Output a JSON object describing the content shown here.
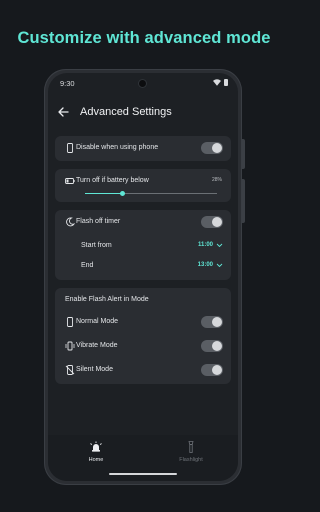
{
  "promo": {
    "title": "Customize with advanced mode"
  },
  "statusbar": {
    "time": "9:30"
  },
  "appbar": {
    "title": "Advanced Settings"
  },
  "settings": {
    "disable_when_using_phone": {
      "label": "Disable when using phone",
      "enabled": false
    },
    "battery": {
      "label": "Turn off if battery below",
      "value_text": "28%",
      "level": 0.28
    },
    "flash_off_timer": {
      "label": "Flash off timer",
      "enabled": false,
      "start": {
        "label": "Start from",
        "value": "11:00"
      },
      "end": {
        "label": "End",
        "value": "13:00"
      }
    },
    "modes": {
      "title": "Enable Flash Alert in Mode",
      "items": [
        {
          "label": "Normal Mode",
          "icon": "phone-icon",
          "enabled": false
        },
        {
          "label": "Vibrate Mode",
          "icon": "vibrate-icon",
          "enabled": false
        },
        {
          "label": "Silent Mode",
          "icon": "silent-icon",
          "enabled": false
        }
      ]
    }
  },
  "bottom_nav": {
    "items": [
      {
        "label": "Home",
        "icon": "home-alert-icon",
        "active": true
      },
      {
        "label": "Flashlight",
        "icon": "flashlight-icon",
        "active": false
      }
    ]
  },
  "colors": {
    "accent": "#5fe6d5",
    "background": "#16191d",
    "card": "#2a2d32"
  }
}
